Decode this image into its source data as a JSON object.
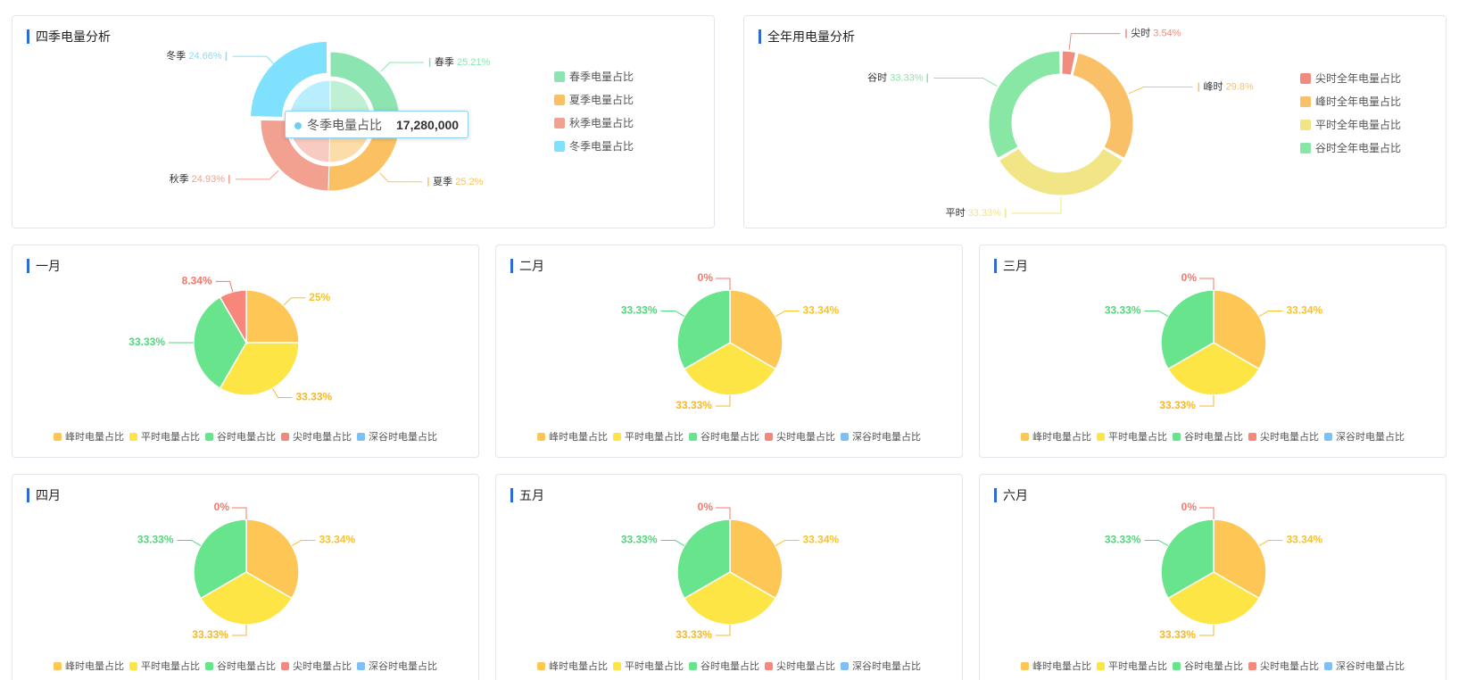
{
  "colors": {
    "peak": "#fec654",
    "flat": "#fce545",
    "valley": "#68e48d",
    "sharp": "#f7877b",
    "deep": "#80bff5",
    "spring": "#8ce4b1",
    "summer": "#fbc062",
    "autumn": "#f2a191",
    "winter": "#7fe1fd"
  },
  "seasons": {
    "title": "四季电量分析",
    "tooltip": {
      "name": "冬季电量占比",
      "value": "17,280,000"
    },
    "legend": [
      "春季电量占比",
      "夏季电量占比",
      "秋季电量占比",
      "冬季电量占比"
    ],
    "chart_data": {
      "type": "pie",
      "style": "rose-donut",
      "series": [
        {
          "label": "春季",
          "pct_label": "25.21%",
          "value": 25.21,
          "color": "#8ce4b1",
          "emphasized": false
        },
        {
          "label": "夏季",
          "pct_label": "25.2%",
          "value": 25.2,
          "color": "#fbc062",
          "emphasized": false
        },
        {
          "label": "秋季",
          "pct_label": "24.93%",
          "value": 24.93,
          "color": "#f2a191",
          "emphasized": false
        },
        {
          "label": "冬季",
          "pct_label": "24.66%",
          "value": 24.66,
          "color": "#7fe1fd",
          "emphasized": true
        }
      ]
    }
  },
  "annual": {
    "title": "全年用电量分析",
    "legend": [
      "尖时全年电量占比",
      "峰时全年电量占比",
      "平时全年电量占比",
      "谷时全年电量占比"
    ],
    "chart_data": {
      "type": "pie",
      "style": "donut",
      "series": [
        {
          "label": "尖时",
          "pct_label": "3.54%",
          "value": 3.54,
          "color": "#f08b80"
        },
        {
          "label": "峰时",
          "pct_label": "29.8%",
          "value": 29.8,
          "color": "#f9c068"
        },
        {
          "label": "平时",
          "pct_label": "33.33%",
          "value": 33.33,
          "color": "#f1e585"
        },
        {
          "label": "谷时",
          "pct_label": "33.33%",
          "value": 33.33,
          "color": "#88e7a5"
        }
      ]
    }
  },
  "month_legend": [
    "峰时电量占比",
    "平时电量占比",
    "谷时电量占比",
    "尖时电量占比",
    "深谷时电量占比"
  ],
  "months": [
    {
      "title": "一月",
      "chart_data": {
        "type": "pie",
        "slices": [
          {
            "category": "峰时电量占比",
            "value": 25,
            "label": "25%"
          },
          {
            "category": "平时电量占比",
            "value": 33.33,
            "label": "33.33%"
          },
          {
            "category": "谷时电量占比",
            "value": 33.33,
            "label": "33.33%"
          },
          {
            "category": "尖时电量占比",
            "value": 8.34,
            "label": "8.34%"
          }
        ]
      }
    },
    {
      "title": "二月",
      "chart_data": {
        "type": "pie",
        "slices": [
          {
            "category": "峰时电量占比",
            "value": 33.34,
            "label": "33.34%"
          },
          {
            "category": "平时电量占比",
            "value": 33.33,
            "label": "33.33%"
          },
          {
            "category": "谷时电量占比",
            "value": 33.33,
            "label": "33.33%"
          },
          {
            "category": "尖时电量占比",
            "value": 0,
            "label": "0%"
          }
        ]
      }
    },
    {
      "title": "三月",
      "chart_data": {
        "type": "pie",
        "slices": [
          {
            "category": "峰时电量占比",
            "value": 33.34,
            "label": "33.34%"
          },
          {
            "category": "平时电量占比",
            "value": 33.33,
            "label": "33.33%"
          },
          {
            "category": "谷时电量占比",
            "value": 33.33,
            "label": "33.33%"
          },
          {
            "category": "尖时电量占比",
            "value": 0,
            "label": "0%"
          }
        ]
      }
    },
    {
      "title": "四月",
      "chart_data": {
        "type": "pie",
        "slices": [
          {
            "category": "峰时电量占比",
            "value": 33.34,
            "label": "33.34%"
          },
          {
            "category": "平时电量占比",
            "value": 33.33,
            "label": "33.33%"
          },
          {
            "category": "谷时电量占比",
            "value": 33.33,
            "label": "33.33%"
          },
          {
            "category": "尖时电量占比",
            "value": 0,
            "label": "0%"
          }
        ]
      }
    },
    {
      "title": "五月",
      "chart_data": {
        "type": "pie",
        "slices": [
          {
            "category": "峰时电量占比",
            "value": 33.34,
            "label": "33.34%"
          },
          {
            "category": "平时电量占比",
            "value": 33.33,
            "label": "33.33%"
          },
          {
            "category": "谷时电量占比",
            "value": 33.33,
            "label": "33.33%"
          },
          {
            "category": "尖时电量占比",
            "value": 0,
            "label": "0%"
          }
        ]
      }
    },
    {
      "title": "六月",
      "chart_data": {
        "type": "pie",
        "slices": [
          {
            "category": "峰时电量占比",
            "value": 33.34,
            "label": "33.34%"
          },
          {
            "category": "平时电量占比",
            "value": 33.33,
            "label": "33.33%"
          },
          {
            "category": "谷时电量占比",
            "value": 33.33,
            "label": "33.33%"
          },
          {
            "category": "尖时电量占比",
            "value": 0,
            "label": "0%"
          }
        ]
      }
    }
  ]
}
